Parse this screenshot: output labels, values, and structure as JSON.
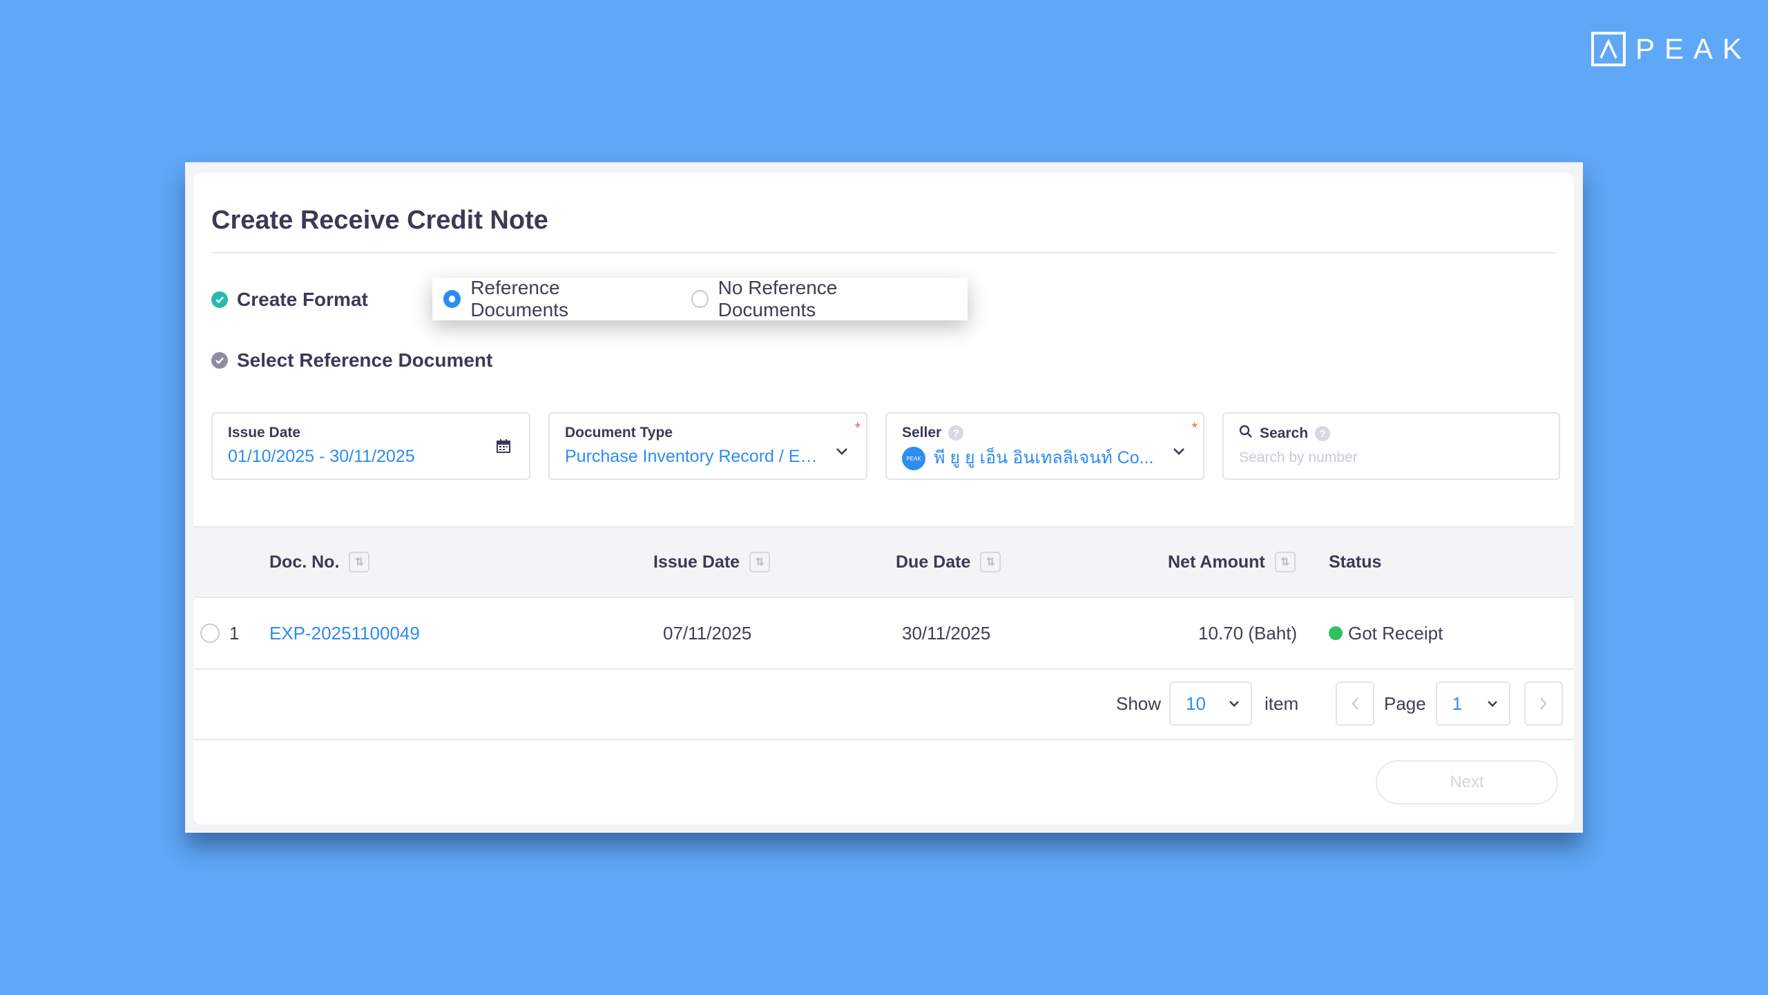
{
  "brand": {
    "name": "PEAK"
  },
  "page": {
    "title": "Create Receive Credit Note"
  },
  "steps": {
    "create_format": "Create Format",
    "select_reference": "Select Reference Document"
  },
  "format_options": {
    "reference": "Reference Documents",
    "no_reference": "No Reference Documents",
    "selected": "reference"
  },
  "filters": {
    "issue_date": {
      "label": "Issue Date",
      "value": "01/10/2025 - 30/11/2025"
    },
    "document_type": {
      "label": "Document Type",
      "value": "Purchase Inventory Record / Ex...",
      "required_mark": "*"
    },
    "seller": {
      "label": "Seller",
      "value": "พี ยู ยู เอ็น อินเทลลิเจนท์ Co...",
      "avatar_text": "PEAK",
      "required_mark": "*"
    },
    "search": {
      "label": "Search",
      "placeholder": "Search by number"
    }
  },
  "table": {
    "columns": {
      "doc_no": "Doc. No.",
      "issue_date": "Issue Date",
      "due_date": "Due Date",
      "net_amount": "Net Amount",
      "status": "Status"
    },
    "rows": [
      {
        "index": "1",
        "doc_no": "EXP-20251100049",
        "issue_date": "07/11/2025",
        "due_date": "30/11/2025",
        "net_amount": "10.70 (Baht)",
        "status": "Got Receipt"
      }
    ]
  },
  "pagination": {
    "show_label": "Show",
    "page_size": "10",
    "item_label": "item",
    "page_label": "Page",
    "page": "1"
  },
  "actions": {
    "next": "Next"
  },
  "colors": {
    "background": "#5fa8f7",
    "accent": "#2d8cf0",
    "step_done": "#27b9b0",
    "status_ok": "#2fc160",
    "required": "#f06a39"
  }
}
